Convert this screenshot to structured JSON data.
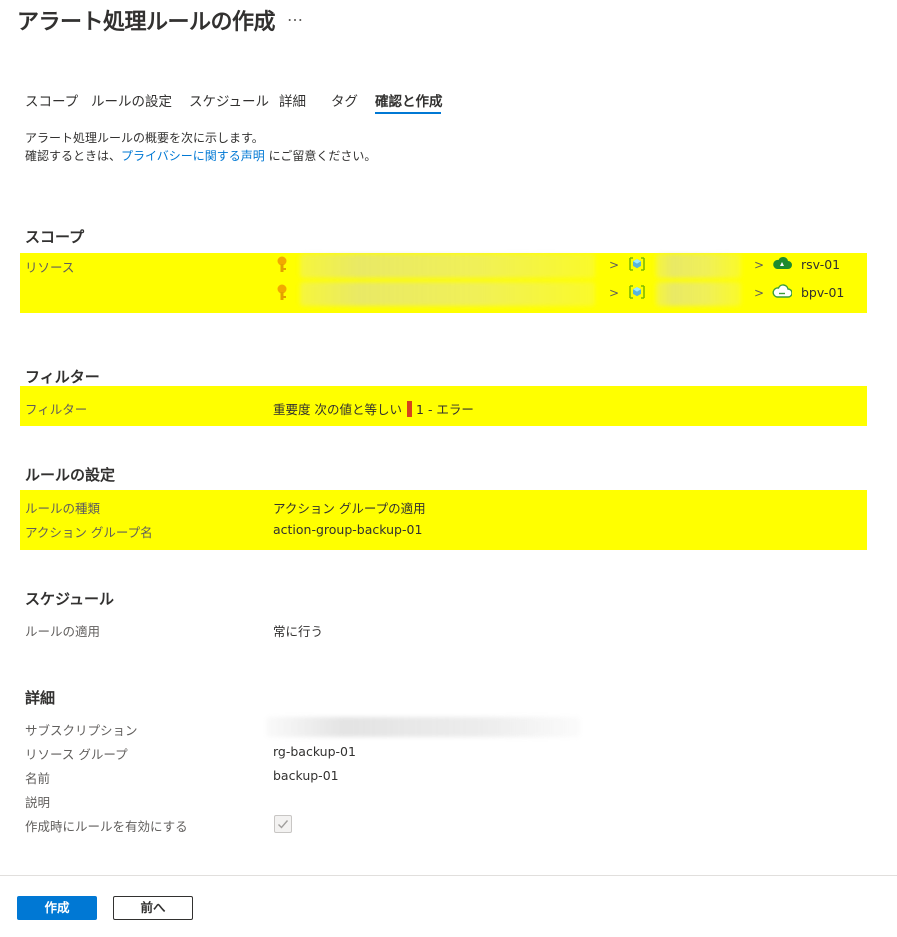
{
  "header": {
    "title": "アラート処理ルールの作成",
    "more": "…"
  },
  "tabs": [
    {
      "label": "スコープ"
    },
    {
      "label": "ルールの設定"
    },
    {
      "label": "スケジュール"
    },
    {
      "label": "詳細"
    },
    {
      "label": "タグ"
    },
    {
      "label": "確認と作成"
    }
  ],
  "intro": {
    "line1": "アラート処理ルールの概要を次に示します。",
    "line2_prefix": "確認するときは、",
    "link": "プライバシーに関する声明",
    "line2_suffix": " にご留意ください。"
  },
  "scope": {
    "heading": "スコープ",
    "label": "リソース",
    "resources": [
      {
        "name": "rsv-01",
        "icon": "recovery-services-vault-icon"
      },
      {
        "name": "bpv-01",
        "icon": "backup-vault-icon"
      }
    ]
  },
  "filters": {
    "heading": "フィルター",
    "label": "フィルター",
    "field": "重要度",
    "operator": "次の値と等しい",
    "value": "1 - エラー",
    "severity_color": "#d6431c"
  },
  "rule_settings": {
    "heading": "ルールの設定",
    "type_label": "ルールの種類",
    "type_value": "アクション グループの適用",
    "group_label": "アクション グループ名",
    "group_value": "action-group-backup-01"
  },
  "schedule": {
    "heading": "スケジュール",
    "apply_label": "ルールの適用",
    "apply_value": "常に行う"
  },
  "details": {
    "heading": "詳細",
    "subscription_label": "サブスクリプション",
    "rg_label": "リソース グループ",
    "rg_value": "rg-backup-01",
    "name_label": "名前",
    "name_value": "backup-01",
    "desc_label": "説明",
    "enable_label": "作成時にルールを有効にする",
    "enable_checked": true
  },
  "footer": {
    "create": "作成",
    "previous": "前へ"
  },
  "colors": {
    "accent": "#0078d4",
    "highlight": "#ffff00"
  }
}
